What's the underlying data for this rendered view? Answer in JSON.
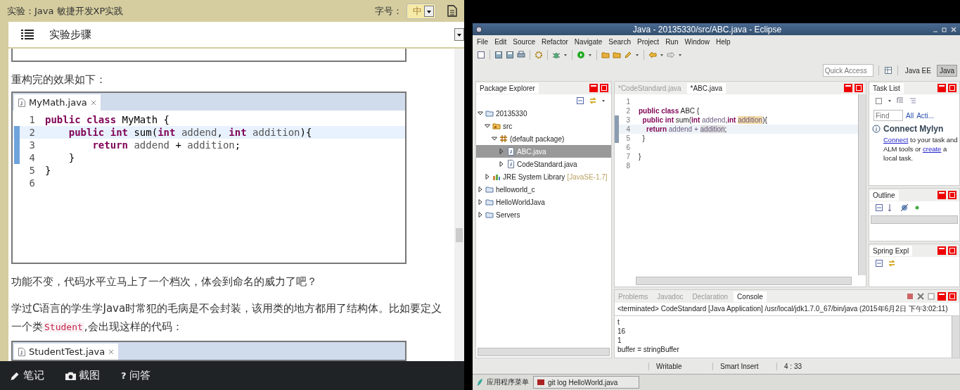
{
  "left_panel": {
    "header": {
      "title": "实验：Java 敏捷开发XP实践",
      "font_size_label": "字号：",
      "font_size_value": "中"
    },
    "section": {
      "title": "实验步骤"
    },
    "content": [
      {
        "kind": "figure_end"
      },
      {
        "kind": "paragraph",
        "segments": [
          {
            "kind": "text",
            "text": "重构完的效果如下："
          }
        ]
      },
      {
        "kind": "code_window",
        "tab": "MyMath.java",
        "lines": [
          {
            "number": "1",
            "current": false,
            "changed": false,
            "tokens": [
              {
                "kind": "keyword",
                "text": "public class"
              },
              {
                "kind": "plain",
                "text": " MyMath {"
              }
            ]
          },
          {
            "number": "2",
            "current": true,
            "changed": true,
            "tokens": [
              {
                "kind": "keyword",
                "text": "    public int"
              },
              {
                "kind": "plain",
                "text": " sum("
              },
              {
                "kind": "keyword",
                "text": "int"
              },
              {
                "kind": "param",
                "text": " addend"
              },
              {
                "kind": "plain",
                "text": ", "
              },
              {
                "kind": "keyword",
                "text": "int"
              },
              {
                "kind": "param",
                "text": " addition"
              },
              {
                "kind": "plain",
                "text": "){"
              }
            ]
          },
          {
            "number": "3",
            "current": false,
            "changed": true,
            "tokens": [
              {
                "kind": "keyword",
                "text": "        return"
              },
              {
                "kind": "param",
                "text": " addend"
              },
              {
                "kind": "plain",
                "text": " + "
              },
              {
                "kind": "param",
                "text": "addition"
              },
              {
                "kind": "plain",
                "text": ";"
              }
            ]
          },
          {
            "number": "4",
            "current": false,
            "changed": true,
            "tokens": [
              {
                "kind": "plain",
                "text": "    }"
              }
            ]
          },
          {
            "number": "5",
            "current": false,
            "changed": false,
            "tokens": [
              {
                "kind": "plain",
                "text": "}"
              }
            ]
          },
          {
            "number": "6",
            "current": false,
            "changed": false
          }
        ]
      },
      {
        "kind": "paragraph",
        "segments": [
          {
            "kind": "text",
            "text": "功能不变，代码水平立马上了一个档次，体会到命名的威力了吧？"
          }
        ]
      },
      {
        "kind": "paragraph",
        "segments": [
          {
            "kind": "text",
            "text": "学过C语言的学生学Java时常犯的毛病是不会封装，该用类的地方都用了结构体。比如要定义一个类"
          },
          {
            "kind": "code",
            "text": "Student"
          },
          {
            "kind": "text",
            "text": ",会出现这样的代码："
          }
        ]
      },
      {
        "kind": "code_window",
        "tab": "StudentTest.java"
      }
    ],
    "actions": [
      {
        "kind": "pencil",
        "label": "笔记"
      },
      {
        "kind": "camera",
        "label": "截图"
      },
      {
        "kind": "glyph",
        "glyph": "?",
        "label": "问答"
      }
    ]
  },
  "eclipse": {
    "title": "Java - 20135330/src/ABC.java - Eclipse",
    "menu": [
      "File",
      "Edit",
      "Source",
      "Refactor",
      "Navigate",
      "Search",
      "Project",
      "Run",
      "Window",
      "Help"
    ],
    "quick_access": {
      "placeholder": "Quick Access"
    },
    "perspectives": [
      {
        "label": "Java EE",
        "selected": false
      },
      {
        "label": "Java",
        "selected": true
      }
    ],
    "package_explorer": {
      "title": "Package Explorer",
      "tree": [
        {
          "label": "20135330",
          "kind": "project",
          "expanded": true,
          "selected": false,
          "children": [
            {
              "label": "src",
              "kind": "source",
              "expanded": true,
              "selected": false,
              "children": [
                {
                  "label": "(default package)",
                  "kind": "package",
                  "expanded": true,
                  "selected": false,
                  "children": [
                    {
                      "label": "ABC.java",
                      "kind": "java",
                      "expanded": false,
                      "selected": true
                    },
                    {
                      "label": "CodeStandard.java",
                      "kind": "java",
                      "expanded": false,
                      "selected": false
                    }
                  ]
                }
              ]
            },
            {
              "label": "JRE System Library",
              "decoration": "[JavaSE-1.7]",
              "kind": "library",
              "expanded": false,
              "selected": false
            }
          ]
        },
        {
          "label": "helloworld_c",
          "kind": "project",
          "expanded": false,
          "selected": false
        },
        {
          "label": "HelloWorldJava",
          "kind": "project",
          "expanded": false,
          "selected": false
        },
        {
          "label": "Servers",
          "kind": "project",
          "expanded": false,
          "selected": false
        }
      ]
    },
    "editor": {
      "tabs": [
        {
          "label": "*CodeStandard.java",
          "selected": false
        },
        {
          "label": "*ABC.java",
          "selected": true
        }
      ],
      "lines": [
        {
          "number": "1",
          "current": false,
          "changed": false
        },
        {
          "number": "2",
          "current": false,
          "changed": false,
          "tokens": [
            {
              "kind": "keyword",
              "text": "public class"
            },
            {
              "kind": "plain",
              "text": " ABC {"
            }
          ]
        },
        {
          "number": "3",
          "current": false,
          "changed": true,
          "tokens": [
            {
              "kind": "keyword",
              "text": "  public int"
            },
            {
              "kind": "plain",
              "text": " sum("
            },
            {
              "kind": "keyword",
              "text": "int"
            },
            {
              "kind": "param",
              "text": " addend"
            },
            {
              "kind": "plain",
              "text": ","
            },
            {
              "kind": "keyword",
              "text": "int "
            },
            {
              "kind": "highlight",
              "text": "addition"
            },
            {
              "kind": "plain",
              "text": "){"
            }
          ]
        },
        {
          "number": "4",
          "current": true,
          "changed": true,
          "tokens": [
            {
              "kind": "keyword",
              "text": "    return"
            },
            {
              "kind": "param",
              "text": " addend + "
            },
            {
              "kind": "mark",
              "text": "addition"
            },
            {
              "kind": "plain",
              "text": ";"
            }
          ]
        },
        {
          "number": "5",
          "current": false,
          "changed": true,
          "tokens": [
            {
              "kind": "plain",
              "text": "  }"
            }
          ]
        },
        {
          "number": "6",
          "current": false,
          "changed": false
        },
        {
          "number": "7",
          "current": false,
          "changed": false,
          "tokens": [
            {
              "kind": "plain",
              "text": "}"
            }
          ]
        },
        {
          "number": "8",
          "current": false,
          "changed": false
        }
      ]
    },
    "task_list": {
      "title": "Task List",
      "find": {
        "placeholder": "Find"
      },
      "filters": [
        "All",
        "Acti..."
      ],
      "mylyn_title": "Connect Mylyn",
      "mylyn_text": [
        {
          "kind": "link",
          "text": "Connect"
        },
        {
          "kind": "text",
          "text": " to your task and ALM tools or "
        },
        {
          "kind": "link",
          "text": "create"
        },
        {
          "kind": "text",
          "text": " a local task."
        }
      ]
    },
    "outline": {
      "title": "Outline"
    },
    "spring_explorer": {
      "title": "Spring Expl"
    },
    "console": {
      "tabs": [
        {
          "label": "Problems",
          "selected": false
        },
        {
          "label": "Javadoc",
          "selected": false
        },
        {
          "label": "Declaration",
          "selected": false
        },
        {
          "label": "Console",
          "selected": true
        }
      ],
      "header": "<terminated> CodeStandard [Java Application] /usr/local/jdk1.7.0_67/bin/java (2015年6月2日 下午3:02:11)",
      "lines": [
        "t",
        "16",
        "1",
        "buffer = stringBuffer"
      ]
    },
    "status_bar": [
      "Writable",
      "Smart Insert",
      "4 : 33"
    ],
    "taskbar": {
      "start": "应用程序菜单",
      "windows": [
        "git log HelloWorld.java"
      ]
    }
  }
}
